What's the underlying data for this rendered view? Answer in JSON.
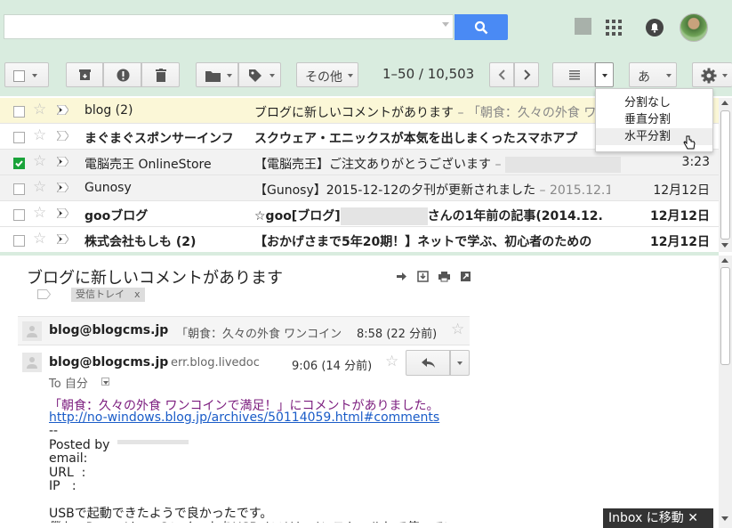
{
  "header": {
    "search_placeholder": "",
    "apps_label": "",
    "notifications_label": ""
  },
  "toolbar": {
    "more_label": "その他",
    "pagination": "1–50 / 10,503",
    "input_tool_label": "あ"
  },
  "split_menu": {
    "items": [
      "分割なし",
      "垂直分割",
      "水平分割"
    ]
  },
  "mail_list": [
    {
      "sender": "blog (2)",
      "subject": "ブログに新しいコメントがあります",
      "snippet": " – 「朝食：久々の外食 ワ",
      "date": "",
      "unread": false,
      "checked": false,
      "highlight": true
    },
    {
      "sender": "まぐまぐスポンサーインフ",
      "subject": "スクウェア・エニックスが本気を出しまくったスマホアプ",
      "snippet": "",
      "date": "",
      "unread": true,
      "checked": false,
      "highlight": false
    },
    {
      "sender": "電脳売王 OnlineStore",
      "subject": "【電脳売王】ご注文ありがとうございます",
      "snippet": " – ",
      "date": "3:23",
      "unread": false,
      "checked": true,
      "highlight": false
    },
    {
      "sender": "Gunosy",
      "subject": "【Gunosy】2015-12-12の夕刊が更新されました",
      "snippet": " – 2015.12.1",
      "date": "12月12日",
      "unread": false,
      "checked": false,
      "highlight": false
    },
    {
      "sender": "gooブログ",
      "subject": "☆goo[ブログ]",
      "subject2": "さんの1年前の記事(2014.12.",
      "snippet": "",
      "date": "12月12日",
      "unread": true,
      "checked": false,
      "highlight": false
    },
    {
      "sender": "株式会社もしも (2)",
      "subject": "【おかげさまで5年20期！】ネットで学ぶ、初心者のための",
      "snippet": "",
      "date": "12月12日",
      "unread": true,
      "checked": false,
      "highlight": false
    }
  ],
  "reading_pane": {
    "subject": "ブログに新しいコメントがあります",
    "label_chip": "受信トレイ　x",
    "collapsed_sender": "blog@blogcms.jp",
    "collapsed_snippet": "「朝食：久々の外食 ワンコイン",
    "collapsed_time": "8:58 (22 分前)",
    "expanded_sender": "blog@blogcms.jp",
    "expanded_via": "err.blog.livedoc",
    "expanded_time": "9:06 (14 分前)",
    "to_label": "To 自分",
    "body_line1": "「朝食：久々の外食 ワンコインで満足！」にコメントがありました。",
    "body_link": "http://no-windows.blog.jp/archives/50114059.html#comments",
    "body_rest": "--\nPosted by\nemail:\nURL  :\nIP   :\n\nUSBで起動できたようで良かったです。\n僕も、PuppyLinuxのいくつかをUSBメモリにインストールして使ってい"
  },
  "banner": {
    "label": "Inbox に移動 ✕"
  },
  "colors": {
    "theme_green": "#d9ecdf",
    "search_blue": "#4a8af4",
    "link_blue": "#1a5cc8",
    "comment_purple": "#7b1c7e"
  }
}
